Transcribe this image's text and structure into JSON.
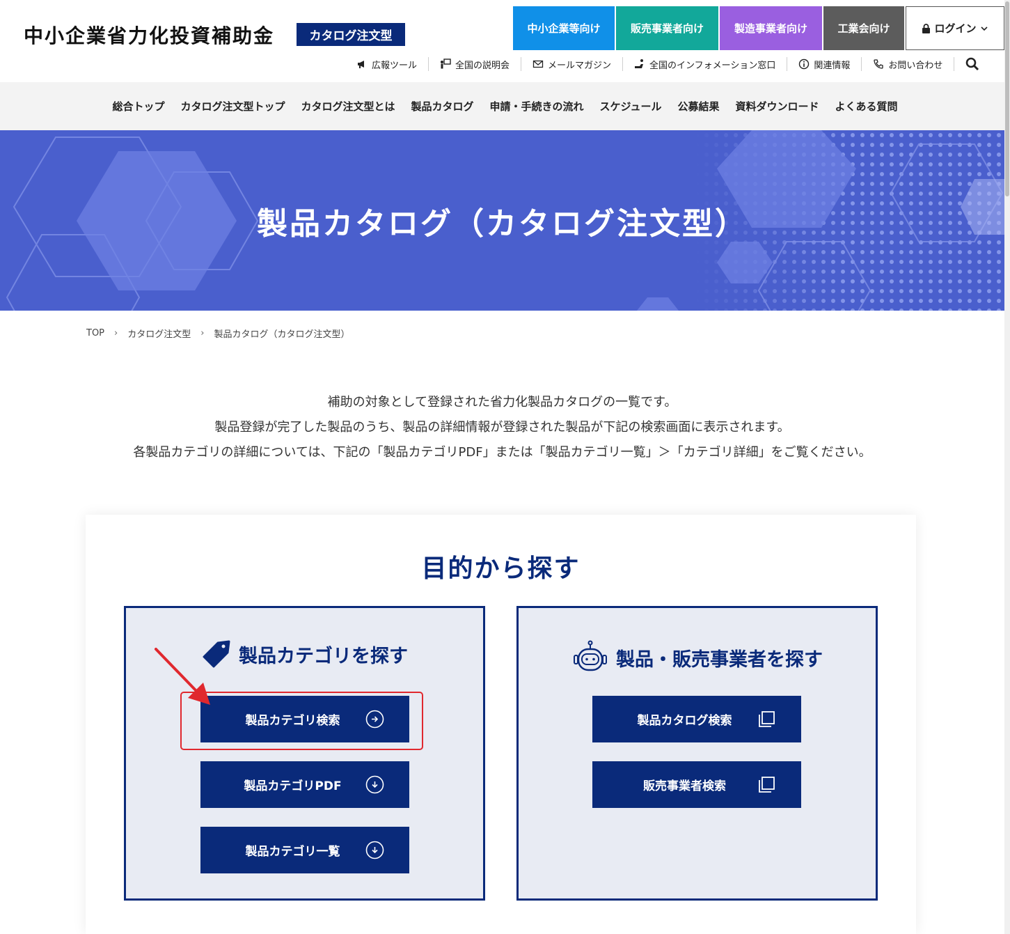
{
  "header": {
    "site_title": "中小企業省力化投資補助金",
    "badge": "カタログ注文型",
    "audience": [
      "中小企業等向け",
      "販売事業者向け",
      "製造事業者向け",
      "工業会向け"
    ],
    "login": "ログイン",
    "utility": [
      {
        "label": "広報ツール",
        "icon": "megaphone-icon"
      },
      {
        "label": "全国の説明会",
        "icon": "presenter-icon"
      },
      {
        "label": "メールマガジン",
        "icon": "mail-icon"
      },
      {
        "label": "全国のインフォメーション窓口",
        "icon": "desk-icon"
      },
      {
        "label": "関連情報",
        "icon": "info-icon"
      },
      {
        "label": "お問い合わせ",
        "icon": "phone-icon"
      }
    ]
  },
  "nav": [
    "総合トップ",
    "カタログ注文型トップ",
    "カタログ注文型とは",
    "製品カタログ",
    "申請・手続きの流れ",
    "スケジュール",
    "公募結果",
    "資料ダウンロード",
    "よくある質問"
  ],
  "hero": {
    "title": "製品カタログ（カタログ注文型）"
  },
  "breadcrumb": [
    "TOP",
    "カタログ注文型",
    "製品カタログ（カタログ注文型）"
  ],
  "intro": [
    "補助の対象として登録された省力化製品カタログの一覧です。",
    "製品登録が完了した製品のうち、製品の詳細情報が登録された製品が下記の検索画面に表示されます。",
    "各製品カテゴリの詳細については、下記の「製品カテゴリPDF」または「製品カテゴリ一覧」＞「カテゴリ詳細」をご覧ください。"
  ],
  "purpose": {
    "title": "目的から探す",
    "left": {
      "heading": "製品カテゴリを探す",
      "buttons": [
        "製品カテゴリ検索",
        "製品カテゴリPDF",
        "製品カテゴリ一覧"
      ]
    },
    "right": {
      "heading": "製品・販売事業者を探す",
      "buttons": [
        "製品カタログ検索",
        "販売事業者検索"
      ]
    }
  },
  "colors": {
    "navy": "#0a2a7a",
    "hero": "#4a5fcd",
    "highlight": "#e0282e"
  }
}
